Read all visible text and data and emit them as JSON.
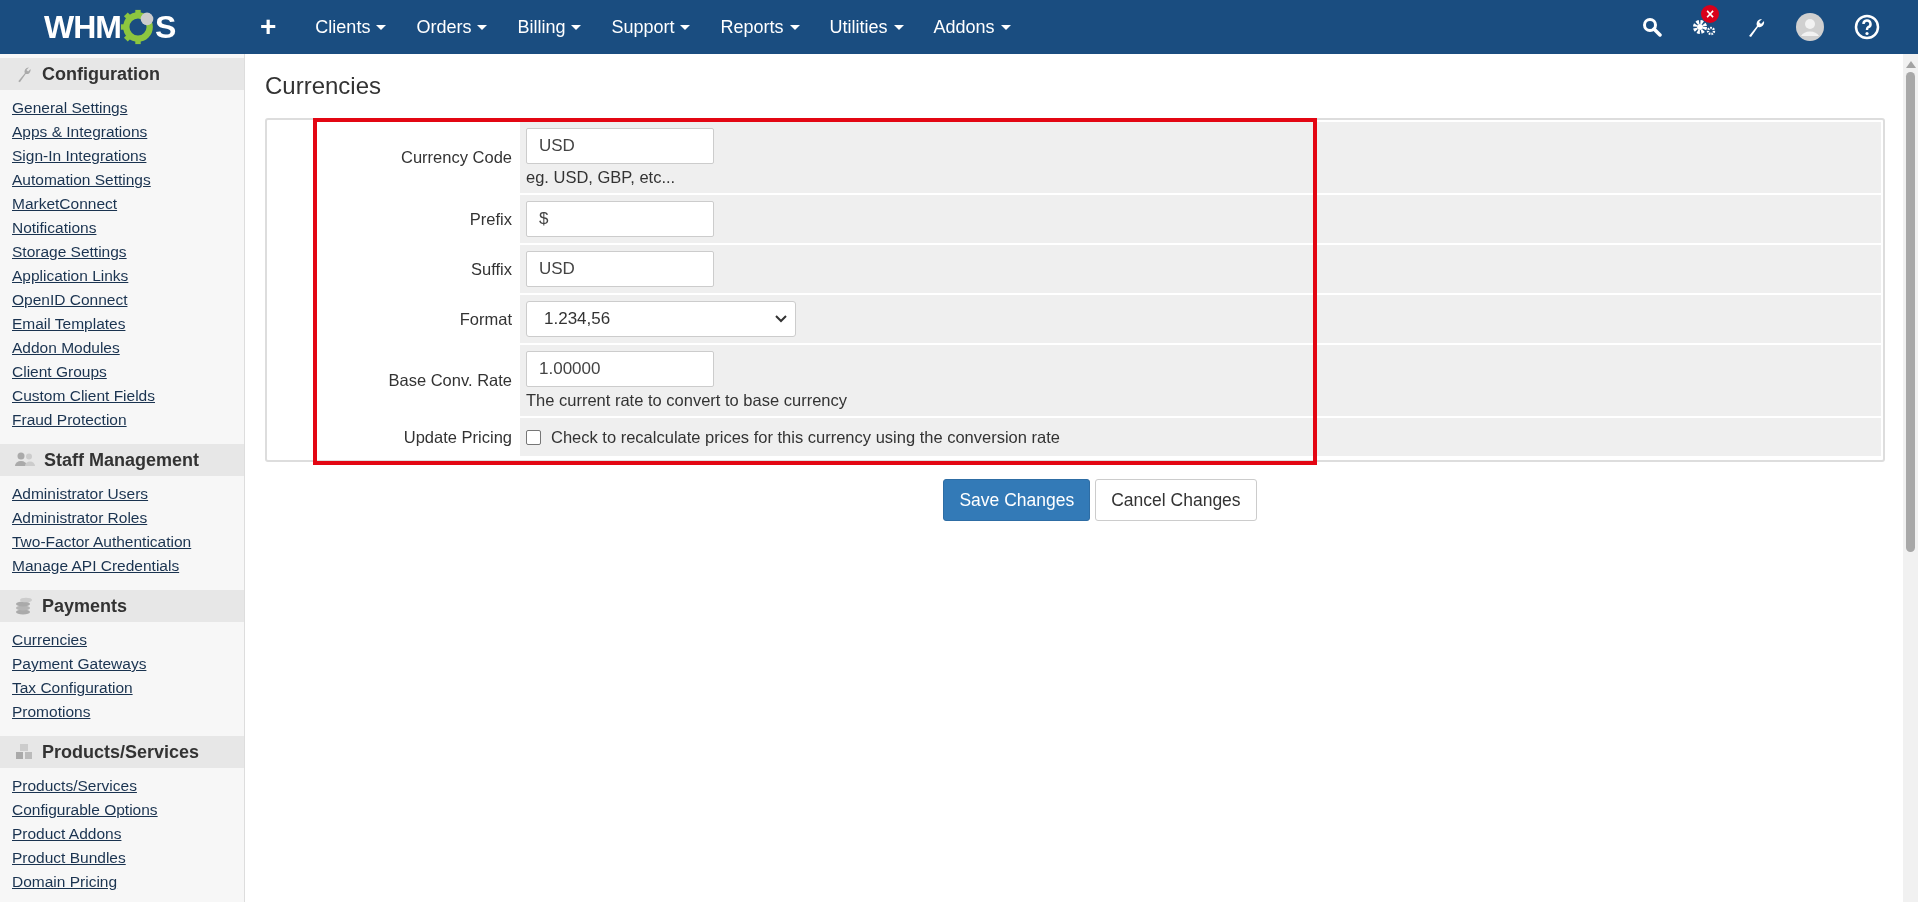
{
  "topbar": {
    "logo": {
      "start": "WHM",
      "end": "S"
    },
    "add": "+",
    "menus": [
      "Clients",
      "Orders",
      "Billing",
      "Support",
      "Reports",
      "Utilities",
      "Addons"
    ],
    "alert_badge": "×"
  },
  "sidebar": [
    {
      "title": "Configuration",
      "items": [
        "General Settings",
        "Apps & Integrations",
        "Sign-In Integrations",
        "Automation Settings",
        "MarketConnect",
        "Notifications",
        "Storage Settings",
        "Application Links",
        "OpenID Connect",
        "Email Templates",
        "Addon Modules",
        "Client Groups",
        "Custom Client Fields",
        "Fraud Protection"
      ]
    },
    {
      "title": "Staff Management",
      "items": [
        "Administrator Users",
        "Administrator Roles",
        "Two-Factor Authentication",
        "Manage API Credentials"
      ]
    },
    {
      "title": "Payments",
      "items": [
        "Currencies",
        "Payment Gateways",
        "Tax Configuration",
        "Promotions"
      ]
    },
    {
      "title": "Products/Services",
      "items": [
        "Products/Services",
        "Configurable Options",
        "Product Addons",
        "Product Bundles",
        "Domain Pricing"
      ]
    }
  ],
  "page_title": "Currencies",
  "form": [
    {
      "kind": "text",
      "label": "Currency Code",
      "value": "USD",
      "help": "eg. USD, GBP, etc..."
    },
    {
      "kind": "text",
      "label": "Prefix",
      "value": "$"
    },
    {
      "kind": "text",
      "label": "Suffix",
      "value": "USD"
    },
    {
      "kind": "select",
      "label": "Format",
      "value": "1.234,56"
    },
    {
      "kind": "text",
      "label": "Base Conv. Rate",
      "value": "1.00000",
      "help": "The current rate to convert to base currency"
    },
    {
      "kind": "checkbox",
      "label": "Update Pricing",
      "checked": false,
      "text": "Check to recalculate prices for this currency using the conversion rate"
    }
  ],
  "buttons": [
    {
      "kind": "primary",
      "label": "Save Changes"
    },
    {
      "kind": "default",
      "label": "Cancel Changes"
    }
  ]
}
